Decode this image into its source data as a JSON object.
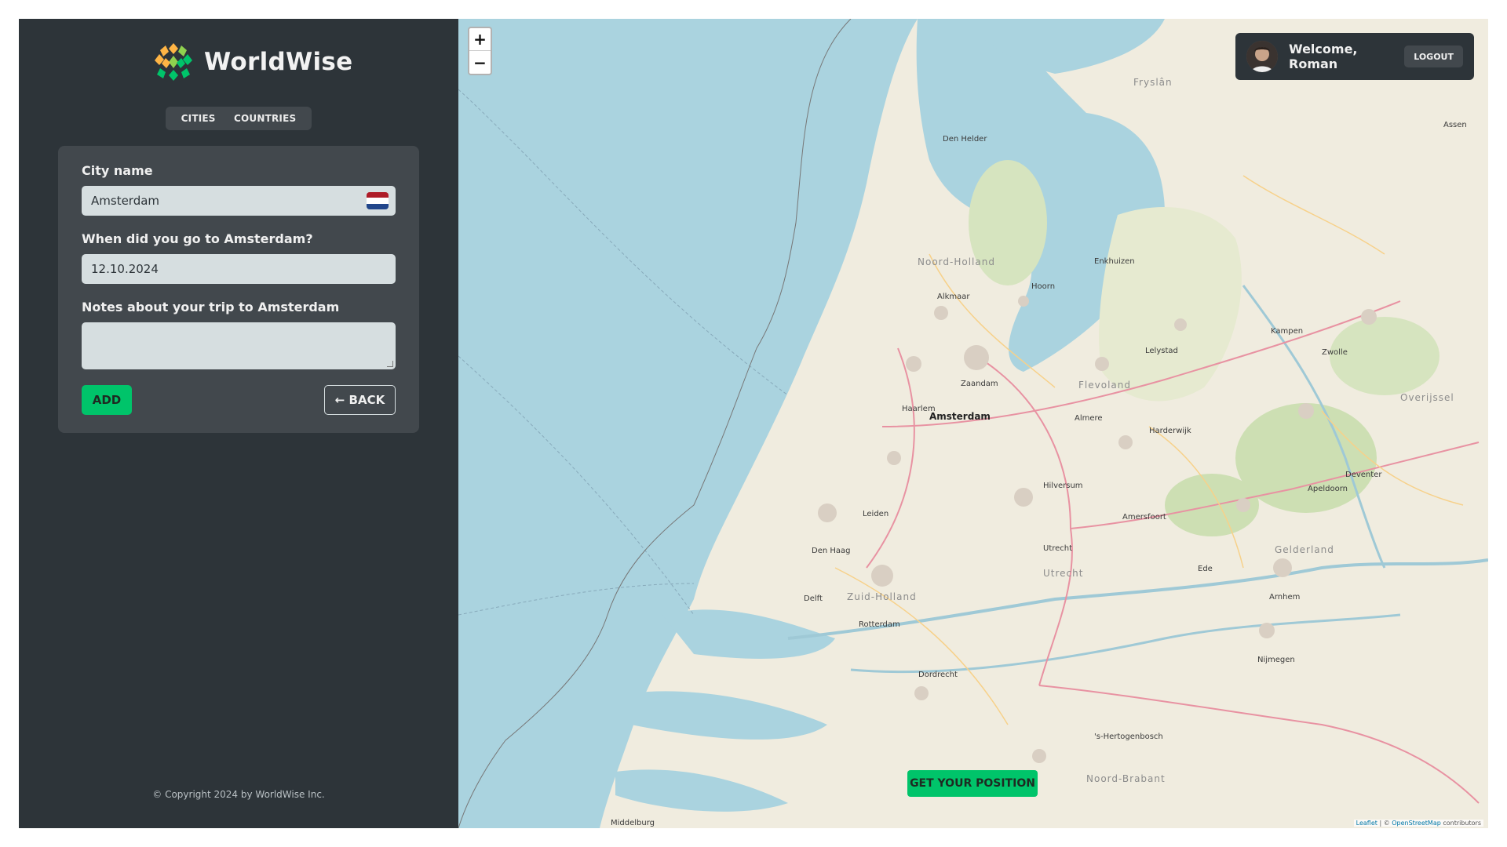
{
  "app": {
    "name": "WorldWise"
  },
  "tabs": [
    {
      "label": "CITIES"
    },
    {
      "label": "COUNTRIES"
    }
  ],
  "form": {
    "city_label": "City name",
    "city_value": "Amsterdam",
    "date_label": "When did you go to Amsterdam?",
    "date_value": "12.10.2024",
    "notes_label": "Notes about your trip to Amsterdam",
    "notes_value": "",
    "add_label": "ADD",
    "back_label": "← BACK"
  },
  "footer": {
    "copyright": "© Copyright 2024 by WorldWise Inc."
  },
  "map": {
    "zoom_in": "+",
    "zoom_out": "−",
    "geolocate_label": "GET YOUR POSITION",
    "attribution_leaflet": "Leaflet",
    "attribution_osm": "OpenStreetMap",
    "attribution_sep": " | © ",
    "attribution_suffix": " contributors",
    "places": [
      {
        "name": "Amsterdam"
      },
      {
        "name": "Haarlem"
      },
      {
        "name": "Den Haag"
      },
      {
        "name": "Rotterdam"
      },
      {
        "name": "Utrecht"
      },
      {
        "name": "Leiden"
      },
      {
        "name": "Almere"
      },
      {
        "name": "Lelystad"
      },
      {
        "name": "Zwolle"
      },
      {
        "name": "Apeldoorn"
      },
      {
        "name": "Arnhem"
      },
      {
        "name": "Nijmegen"
      },
      {
        "name": "Amersfoort"
      },
      {
        "name": "Alkmaar"
      },
      {
        "name": "Dordrecht"
      },
      {
        "name": "Hilversum"
      },
      {
        "name": "Zaandam"
      },
      {
        "name": "Den Helder"
      },
      {
        "name": "Hoorn"
      },
      {
        "name": "Delft"
      },
      {
        "name": "Deventer"
      },
      {
        "name": "Harderwijk"
      },
      {
        "name": "Ede"
      },
      {
        "name": "Assen"
      },
      {
        "name": "Middelburg"
      },
      {
        "name": "'s-Hertogenbosch"
      },
      {
        "name": "Enkhuizen"
      },
      {
        "name": "Kampen"
      }
    ],
    "provinces": [
      {
        "name": "Noord-Holland"
      },
      {
        "name": "Flevoland"
      },
      {
        "name": "Zuid-Holland"
      },
      {
        "name": "Utrecht"
      },
      {
        "name": "Gelderland"
      },
      {
        "name": "Overijssel"
      },
      {
        "name": "Noord-Brabant"
      },
      {
        "name": "Fryslân"
      }
    ]
  },
  "user": {
    "welcome": "Welcome, Roman",
    "logout_label": "LOGOUT"
  },
  "colors": {
    "accent": "#00c46a",
    "sidebar": "#2d3439",
    "panel": "#42484d",
    "water": "#aad3df",
    "land": "#f2efe9"
  }
}
